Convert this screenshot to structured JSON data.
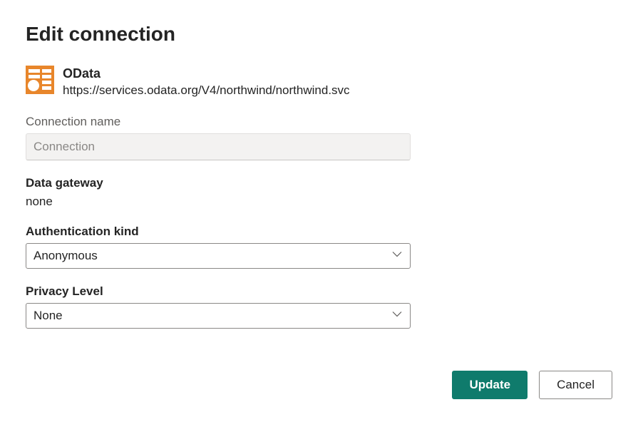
{
  "title": "Edit connection",
  "connector": {
    "icon": "odata-icon",
    "name": "OData",
    "url": "https://services.odata.org/V4/northwind/northwind.svc"
  },
  "connection_name": {
    "label": "Connection name",
    "placeholder": "Connection",
    "value": ""
  },
  "data_gateway": {
    "label": "Data gateway",
    "value": "none"
  },
  "authentication_kind": {
    "label": "Authentication kind",
    "value": "Anonymous"
  },
  "privacy_level": {
    "label": "Privacy Level",
    "value": "None"
  },
  "buttons": {
    "update": "Update",
    "cancel": "Cancel"
  }
}
